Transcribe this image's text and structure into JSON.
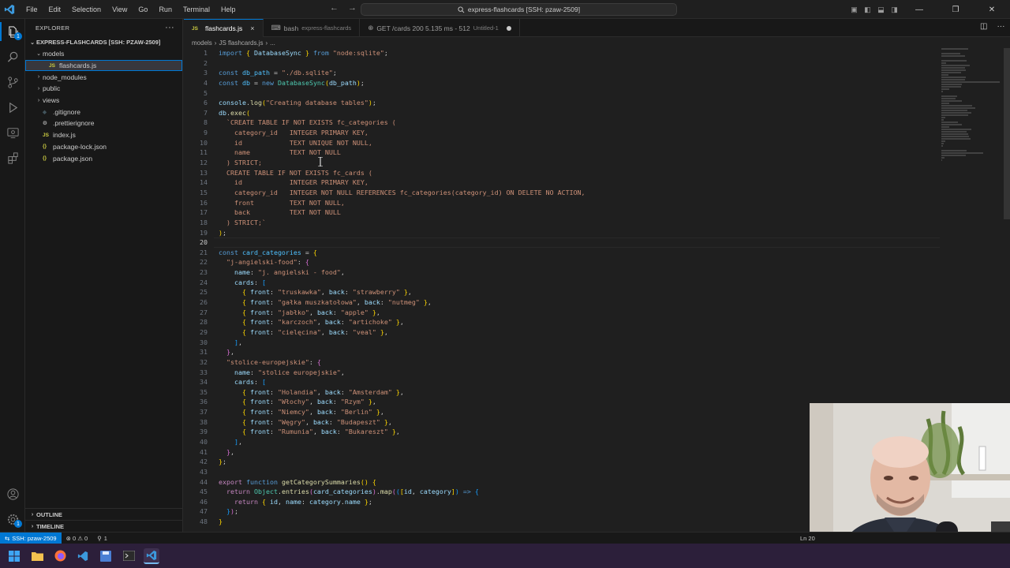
{
  "menu": [
    "File",
    "Edit",
    "Selection",
    "View",
    "Go",
    "Run",
    "Terminal",
    "Help"
  ],
  "command_center": "express-flashcards [SSH: pzaw-2509]",
  "explorer": {
    "title": "EXPLORER",
    "root": "EXPRESS-FLASHCARDS [SSH: PZAW-2509]",
    "items": [
      {
        "label": "models",
        "kind": "folder-open",
        "indent": 1
      },
      {
        "label": "flashcards.js",
        "kind": "js",
        "indent": 2,
        "selected": true
      },
      {
        "label": "node_modules",
        "kind": "folder",
        "indent": 1
      },
      {
        "label": "public",
        "kind": "folder",
        "indent": 1
      },
      {
        "label": "views",
        "kind": "folder",
        "indent": 1
      },
      {
        "label": ".gitignore",
        "kind": "git",
        "indent": 1
      },
      {
        "label": ".prettierignore",
        "kind": "gear",
        "indent": 1
      },
      {
        "label": "index.js",
        "kind": "js",
        "indent": 1
      },
      {
        "label": "package-lock.json",
        "kind": "json",
        "indent": 1
      },
      {
        "label": "package.json",
        "kind": "json",
        "indent": 1
      }
    ],
    "outline": "OUTLINE",
    "timeline": "TIMELINE"
  },
  "tabs": [
    {
      "icon": "JS",
      "label": "flashcards.js",
      "desc": "",
      "active": true,
      "trail": "close"
    },
    {
      "icon": "bash-icon",
      "label": "bash",
      "desc": "express-flashcards",
      "active": false,
      "trail": ""
    },
    {
      "icon": "globe-icon",
      "label": "GET /cards 200 5.135 ms - 512",
      "desc": "Untitled-1",
      "active": false,
      "trail": "dot"
    }
  ],
  "breadcrumb": [
    "models",
    "JS flashcards.js",
    "..."
  ],
  "code": {
    "current_line": 20,
    "lines": [
      [
        [
          "kw",
          "import"
        ],
        [
          "p",
          " "
        ],
        [
          "br1",
          "{"
        ],
        [
          "p",
          " "
        ],
        [
          "var",
          "DatabaseSync"
        ],
        [
          "p",
          " "
        ],
        [
          "br1",
          "}"
        ],
        [
          "p",
          " "
        ],
        [
          "kw",
          "from"
        ],
        [
          "p",
          " "
        ],
        [
          "str",
          "\"node:sqlite\""
        ],
        [
          "p",
          ";"
        ]
      ],
      [],
      [
        [
          "kw",
          "const"
        ],
        [
          "p",
          " "
        ],
        [
          "cnst",
          "db_path"
        ],
        [
          "p",
          " = "
        ],
        [
          "str",
          "\"./db.sqlite\""
        ],
        [
          "p",
          ";"
        ]
      ],
      [
        [
          "kw",
          "const"
        ],
        [
          "p",
          " "
        ],
        [
          "cnst",
          "db"
        ],
        [
          "p",
          " = "
        ],
        [
          "kw",
          "new"
        ],
        [
          "p",
          " "
        ],
        [
          "cls",
          "DatabaseSync"
        ],
        [
          "br1",
          "("
        ],
        [
          "var",
          "db_path"
        ],
        [
          "br1",
          ")"
        ],
        [
          "p",
          ";"
        ]
      ],
      [],
      [
        [
          "var",
          "console"
        ],
        [
          "p",
          "."
        ],
        [
          "fn",
          "log"
        ],
        [
          "br1",
          "("
        ],
        [
          "str",
          "\"Creating database tables\""
        ],
        [
          "br1",
          ")"
        ],
        [
          "p",
          ";"
        ]
      ],
      [
        [
          "var",
          "db"
        ],
        [
          "p",
          "."
        ],
        [
          "fn",
          "exec"
        ],
        [
          "br1",
          "("
        ]
      ],
      [
        [
          "str",
          "  `CREATE TABLE IF NOT EXISTS fc_categories ("
        ]
      ],
      [
        [
          "str",
          "    category_id   INTEGER PRIMARY KEY,"
        ]
      ],
      [
        [
          "str",
          "    id            TEXT UNIQUE NOT NULL,"
        ]
      ],
      [
        [
          "str",
          "    name          TEXT NOT NULL"
        ]
      ],
      [
        [
          "str",
          "  ) STRICT;"
        ]
      ],
      [
        [
          "str",
          "  CREATE TABLE IF NOT EXISTS fc_cards ("
        ]
      ],
      [
        [
          "str",
          "    id            INTEGER PRIMARY KEY,"
        ]
      ],
      [
        [
          "str",
          "    category_id   INTEGER NOT NULL REFERENCES fc_categories(category_id) ON DELETE NO ACTION,"
        ]
      ],
      [
        [
          "str",
          "    front         TEXT NOT NULL,"
        ]
      ],
      [
        [
          "str",
          "    back          TEXT NOT NULL"
        ]
      ],
      [
        [
          "str",
          "  ) STRICT;`"
        ]
      ],
      [
        [
          "br1",
          ")"
        ],
        [
          "p",
          ";"
        ]
      ],
      [],
      [
        [
          "kw",
          "const"
        ],
        [
          "p",
          " "
        ],
        [
          "cnst",
          "card_categories"
        ],
        [
          "p",
          " = "
        ],
        [
          "br1",
          "{"
        ]
      ],
      [
        [
          "p",
          "  "
        ],
        [
          "str",
          "\"j-angielski-food\""
        ],
        [
          "p",
          ": "
        ],
        [
          "br2",
          "{"
        ]
      ],
      [
        [
          "p",
          "    "
        ],
        [
          "var",
          "name"
        ],
        [
          "p",
          ": "
        ],
        [
          "str",
          "\"j. angielski - food\""
        ],
        [
          "p",
          ","
        ]
      ],
      [
        [
          "p",
          "    "
        ],
        [
          "var",
          "cards"
        ],
        [
          "p",
          ": "
        ],
        [
          "br3",
          "["
        ]
      ],
      [
        [
          "p",
          "      "
        ],
        [
          "br1",
          "{"
        ],
        [
          "p",
          " "
        ],
        [
          "var",
          "front"
        ],
        [
          "p",
          ": "
        ],
        [
          "str",
          "\"truskawka\""
        ],
        [
          "p",
          ", "
        ],
        [
          "var",
          "back"
        ],
        [
          "p",
          ": "
        ],
        [
          "str",
          "\"strawberry\""
        ],
        [
          "p",
          " "
        ],
        [
          "br1",
          "}"
        ],
        [
          "p",
          ","
        ]
      ],
      [
        [
          "p",
          "      "
        ],
        [
          "br1",
          "{"
        ],
        [
          "p",
          " "
        ],
        [
          "var",
          "front"
        ],
        [
          "p",
          ": "
        ],
        [
          "str",
          "\"gałka muszkatołowa\""
        ],
        [
          "p",
          ", "
        ],
        [
          "var",
          "back"
        ],
        [
          "p",
          ": "
        ],
        [
          "str",
          "\"nutmeg\""
        ],
        [
          "p",
          " "
        ],
        [
          "br1",
          "}"
        ],
        [
          "p",
          ","
        ]
      ],
      [
        [
          "p",
          "      "
        ],
        [
          "br1",
          "{"
        ],
        [
          "p",
          " "
        ],
        [
          "var",
          "front"
        ],
        [
          "p",
          ": "
        ],
        [
          "str",
          "\"jabłko\""
        ],
        [
          "p",
          ", "
        ],
        [
          "var",
          "back"
        ],
        [
          "p",
          ": "
        ],
        [
          "str",
          "\"apple\""
        ],
        [
          "p",
          " "
        ],
        [
          "br1",
          "}"
        ],
        [
          "p",
          ","
        ]
      ],
      [
        [
          "p",
          "      "
        ],
        [
          "br1",
          "{"
        ],
        [
          "p",
          " "
        ],
        [
          "var",
          "front"
        ],
        [
          "p",
          ": "
        ],
        [
          "str",
          "\"karczoch\""
        ],
        [
          "p",
          ", "
        ],
        [
          "var",
          "back"
        ],
        [
          "p",
          ": "
        ],
        [
          "str",
          "\"artichoke\""
        ],
        [
          "p",
          " "
        ],
        [
          "br1",
          "}"
        ],
        [
          "p",
          ","
        ]
      ],
      [
        [
          "p",
          "      "
        ],
        [
          "br1",
          "{"
        ],
        [
          "p",
          " "
        ],
        [
          "var",
          "front"
        ],
        [
          "p",
          ": "
        ],
        [
          "str",
          "\"cielęcina\""
        ],
        [
          "p",
          ", "
        ],
        [
          "var",
          "back"
        ],
        [
          "p",
          ": "
        ],
        [
          "str",
          "\"veal\""
        ],
        [
          "p",
          " "
        ],
        [
          "br1",
          "}"
        ],
        [
          "p",
          ","
        ]
      ],
      [
        [
          "p",
          "    "
        ],
        [
          "br3",
          "]"
        ],
        [
          "p",
          ","
        ]
      ],
      [
        [
          "p",
          "  "
        ],
        [
          "br2",
          "}"
        ],
        [
          "p",
          ","
        ]
      ],
      [
        [
          "p",
          "  "
        ],
        [
          "str",
          "\"stolice-europejskie\""
        ],
        [
          "p",
          ": "
        ],
        [
          "br2",
          "{"
        ]
      ],
      [
        [
          "p",
          "    "
        ],
        [
          "var",
          "name"
        ],
        [
          "p",
          ": "
        ],
        [
          "str",
          "\"stolice europejskie\""
        ],
        [
          "p",
          ","
        ]
      ],
      [
        [
          "p",
          "    "
        ],
        [
          "var",
          "cards"
        ],
        [
          "p",
          ": "
        ],
        [
          "br3",
          "["
        ]
      ],
      [
        [
          "p",
          "      "
        ],
        [
          "br1",
          "{"
        ],
        [
          "p",
          " "
        ],
        [
          "var",
          "front"
        ],
        [
          "p",
          ": "
        ],
        [
          "str",
          "\"Holandia\""
        ],
        [
          "p",
          ", "
        ],
        [
          "var",
          "back"
        ],
        [
          "p",
          ": "
        ],
        [
          "str",
          "\"Amsterdam\""
        ],
        [
          "p",
          " "
        ],
        [
          "br1",
          "}"
        ],
        [
          "p",
          ","
        ]
      ],
      [
        [
          "p",
          "      "
        ],
        [
          "br1",
          "{"
        ],
        [
          "p",
          " "
        ],
        [
          "var",
          "front"
        ],
        [
          "p",
          ": "
        ],
        [
          "str",
          "\"Włochy\""
        ],
        [
          "p",
          ", "
        ],
        [
          "var",
          "back"
        ],
        [
          "p",
          ": "
        ],
        [
          "str",
          "\"Rzym\""
        ],
        [
          "p",
          " "
        ],
        [
          "br1",
          "}"
        ],
        [
          "p",
          ","
        ]
      ],
      [
        [
          "p",
          "      "
        ],
        [
          "br1",
          "{"
        ],
        [
          "p",
          " "
        ],
        [
          "var",
          "front"
        ],
        [
          "p",
          ": "
        ],
        [
          "str",
          "\"Niemcy\""
        ],
        [
          "p",
          ", "
        ],
        [
          "var",
          "back"
        ],
        [
          "p",
          ": "
        ],
        [
          "str",
          "\"Berlin\""
        ],
        [
          "p",
          " "
        ],
        [
          "br1",
          "}"
        ],
        [
          "p",
          ","
        ]
      ],
      [
        [
          "p",
          "      "
        ],
        [
          "br1",
          "{"
        ],
        [
          "p",
          " "
        ],
        [
          "var",
          "front"
        ],
        [
          "p",
          ": "
        ],
        [
          "str",
          "\"Węgry\""
        ],
        [
          "p",
          ", "
        ],
        [
          "var",
          "back"
        ],
        [
          "p",
          ": "
        ],
        [
          "str",
          "\"Budapeszt\""
        ],
        [
          "p",
          " "
        ],
        [
          "br1",
          "}"
        ],
        [
          "p",
          ","
        ]
      ],
      [
        [
          "p",
          "      "
        ],
        [
          "br1",
          "{"
        ],
        [
          "p",
          " "
        ],
        [
          "var",
          "front"
        ],
        [
          "p",
          ": "
        ],
        [
          "str",
          "\"Rumunia\""
        ],
        [
          "p",
          ", "
        ],
        [
          "var",
          "back"
        ],
        [
          "p",
          ": "
        ],
        [
          "str",
          "\"Bukareszt\""
        ],
        [
          "p",
          " "
        ],
        [
          "br1",
          "}"
        ],
        [
          "p",
          ","
        ]
      ],
      [
        [
          "p",
          "    "
        ],
        [
          "br3",
          "]"
        ],
        [
          "p",
          ","
        ]
      ],
      [
        [
          "p",
          "  "
        ],
        [
          "br2",
          "}"
        ],
        [
          "p",
          ","
        ]
      ],
      [
        [
          "br1",
          "}"
        ],
        [
          "p",
          ";"
        ]
      ],
      [],
      [
        [
          "ctl",
          "export"
        ],
        [
          "p",
          " "
        ],
        [
          "kw",
          "function"
        ],
        [
          "p",
          " "
        ],
        [
          "fn",
          "getCategorySummaries"
        ],
        [
          "br1",
          "()"
        ],
        [
          "p",
          " "
        ],
        [
          "br1",
          "{"
        ]
      ],
      [
        [
          "p",
          "  "
        ],
        [
          "ctl",
          "return"
        ],
        [
          "p",
          " "
        ],
        [
          "cls",
          "Object"
        ],
        [
          "p",
          "."
        ],
        [
          "fn",
          "entries"
        ],
        [
          "br2",
          "("
        ],
        [
          "var",
          "card_categories"
        ],
        [
          "br2",
          ")"
        ],
        [
          "p",
          "."
        ],
        [
          "fn",
          "map"
        ],
        [
          "br2",
          "("
        ],
        [
          "br3",
          "("
        ],
        [
          "br1",
          "["
        ],
        [
          "var",
          "id"
        ],
        [
          "p",
          ", "
        ],
        [
          "var",
          "category"
        ],
        [
          "br1",
          "]"
        ],
        [
          "br3",
          ")"
        ],
        [
          "p",
          " "
        ],
        [
          "kw",
          "=>"
        ],
        [
          "p",
          " "
        ],
        [
          "br3",
          "{"
        ]
      ],
      [
        [
          "p",
          "    "
        ],
        [
          "ctl",
          "return"
        ],
        [
          "p",
          " "
        ],
        [
          "br1",
          "{"
        ],
        [
          "p",
          " "
        ],
        [
          "var",
          "id"
        ],
        [
          "p",
          ", "
        ],
        [
          "var",
          "name"
        ],
        [
          "p",
          ": "
        ],
        [
          "var",
          "category"
        ],
        [
          "p",
          "."
        ],
        [
          "var",
          "name"
        ],
        [
          "p",
          " "
        ],
        [
          "br1",
          "}"
        ],
        [
          "p",
          ";"
        ]
      ],
      [
        [
          "p",
          "  "
        ],
        [
          "br3",
          "}"
        ],
        [
          "br2",
          ")"
        ],
        [
          "p",
          ";"
        ]
      ],
      [
        [
          "br1",
          "}"
        ]
      ]
    ]
  },
  "status": {
    "remote": "SSH: pzaw-2509",
    "problems": "⊗ 0 ⚠ 0",
    "ports": "1",
    "cursor": "Ln 20"
  },
  "colors": {
    "accent": "#0078d4",
    "editor_bg": "#1f1f1f",
    "taskbar_bg": "#2c1f3a"
  }
}
